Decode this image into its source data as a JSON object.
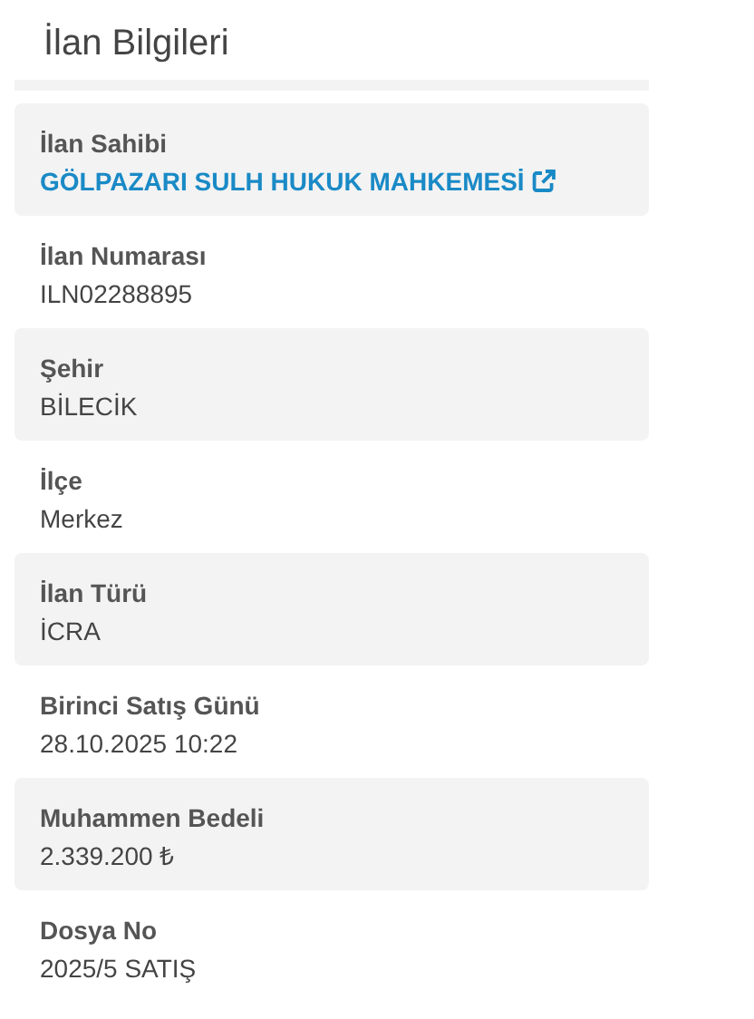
{
  "title": "İlan Bilgileri",
  "fields": [
    {
      "label": "İlan Sahibi",
      "value": "GÖLPAZARI SULH HUKUK MAHKEMESİ",
      "kind": "link"
    },
    {
      "label": "İlan Numarası",
      "value": "ILN02288895",
      "kind": "text"
    },
    {
      "label": "Şehir",
      "value": "BİLECİK",
      "kind": "text"
    },
    {
      "label": "İlçe",
      "value": "Merkez",
      "kind": "text"
    },
    {
      "label": "İlan Türü",
      "value": "İCRA",
      "kind": "text"
    },
    {
      "label": "Birinci Satış Günü",
      "value": "28.10.2025 10:22",
      "kind": "text"
    },
    {
      "label": "Muhammen Bedeli",
      "value": "2.339.200 ₺",
      "kind": "text"
    },
    {
      "label": "Dosya No",
      "value": "2025/5 SATIŞ",
      "kind": "text"
    }
  ]
}
